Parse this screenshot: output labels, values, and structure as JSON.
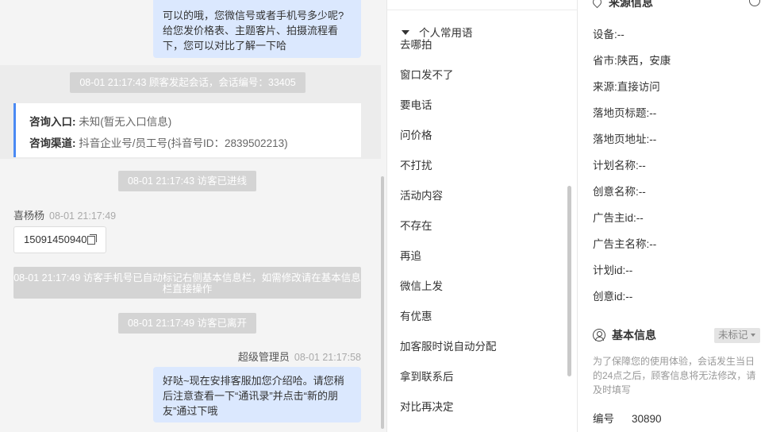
{
  "chat": {
    "agent_bubble_1": "可以的哦，您微信号或者手机号多少呢?给您发价格表、主题客片、拍摄流程看下，您可以对比了解一下哈",
    "session_started": "08-01 21:17:43 顾客发起会话，会话编号：33405",
    "entry_label": "咨询入口:",
    "entry_value": "未知(暂无入口信息)",
    "channel_label": "咨询渠道:",
    "channel_value": "抖音企业号/员工号(抖音号ID：2839502213)",
    "visitor_entered": "08-01 21:17:43 访客已进线",
    "visitor_name": "喜杨杨",
    "visitor_time": "08-01 21:17:49",
    "visitor_phone": "15091450940",
    "auto_tag_notice": "08-01 21:17:49 访客手机号已自动标记右侧基本信息栏，如需修改请在基本信息栏直接操作",
    "visitor_left": "08-01 21:17:49 访客已离开",
    "agent_name": "超级管理员",
    "agent_time": "08-01 21:17:58",
    "agent_bubble_2": "好哒~现在安排客服加您介绍哈。请您稍后注意查看一下“通讯录”并点击“新的朋友”通过下哦"
  },
  "phrases": {
    "header": "个人常用语",
    "items": [
      "去哪拍",
      "窗口发不了",
      "要电话",
      "问价格",
      "不打扰",
      "活动内容",
      "不存在",
      "再追",
      "微信上发",
      "有优惠",
      "加客服时说自动分配",
      "拿到联系后",
      "对比再决定"
    ]
  },
  "source_info": {
    "title": "来源信息",
    "fields": [
      {
        "label": "设备:",
        "value": "--"
      },
      {
        "label": "省市:",
        "value": "陕西，安康"
      },
      {
        "label": "来源:",
        "value": "直接访问"
      },
      {
        "label": "落地页标题:",
        "value": "--"
      },
      {
        "label": "落地页地址:",
        "value": "--"
      },
      {
        "label": "计划名称:",
        "value": "--"
      },
      {
        "label": "创意名称:",
        "value": "--"
      },
      {
        "label": "广告主id:",
        "value": "--"
      },
      {
        "label": "广告主名称:",
        "value": "--"
      },
      {
        "label": "计划id:",
        "value": "--"
      },
      {
        "label": "创意id:",
        "value": "--"
      }
    ]
  },
  "basic_info": {
    "title": "基本信息",
    "tag": "未标记",
    "notice": "为了保障您的使用体验，会话发生当日的24点之后，顾客信息将无法修改，请及时填写",
    "serial_label": "编号",
    "serial_value": "30890"
  },
  "colors": {
    "accent": "#4a8af4",
    "agent_bubble": "#dbe8fe",
    "system_pill": "#d4d4d4"
  },
  "icons": [
    "copy-icon",
    "caret-down-icon",
    "location-pin-icon",
    "shield-icon",
    "user-circle-icon"
  ]
}
